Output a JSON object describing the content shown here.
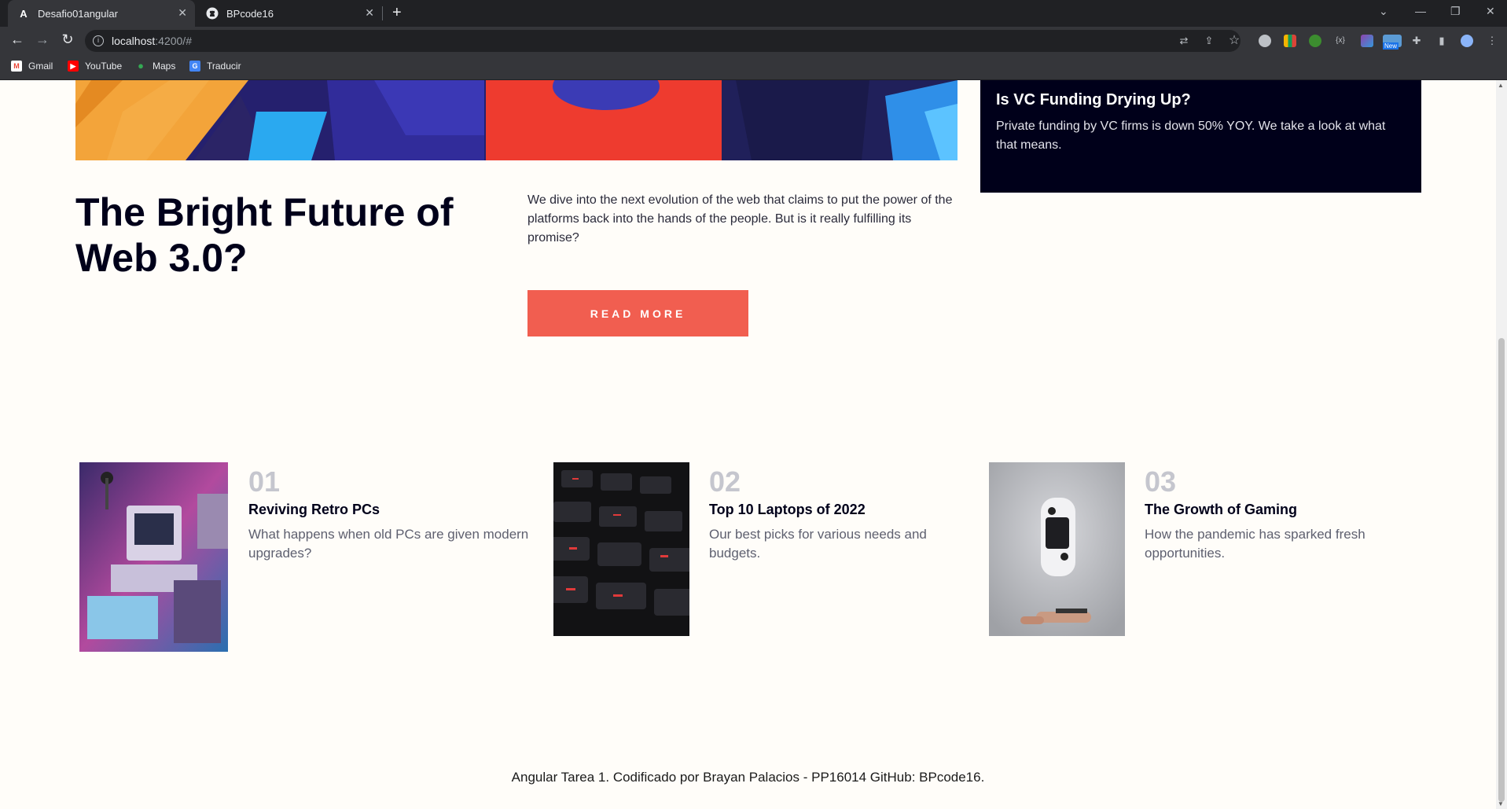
{
  "browser": {
    "tabs": [
      {
        "title": "Desafio01angular",
        "favicon": "angular-icon",
        "active": true
      },
      {
        "title": "BPcode16",
        "favicon": "github-icon",
        "active": false
      }
    ],
    "url": {
      "host": "localhost",
      "path": ":4200/#"
    },
    "bookmarks": [
      {
        "label": "Gmail",
        "icon": "gmail-icon"
      },
      {
        "label": "YouTube",
        "icon": "youtube-icon"
      },
      {
        "label": "Maps",
        "icon": "maps-icon"
      },
      {
        "label": "Traducir",
        "icon": "translate-icon"
      }
    ],
    "ext_badge": "New"
  },
  "hero": {
    "title": "The Bright Future of Web 3.0?",
    "description": "We dive into the next evolution of the web that claims to put the power of the platforms back into the hands of the people. But is it really fulfilling its promise?",
    "button": "READ MORE"
  },
  "sidebar_card": {
    "title": "Is VC Funding Drying Up?",
    "text": "Private funding by VC firms is down 50% YOY. We take a look at what that means."
  },
  "articles": [
    {
      "number": "01",
      "title": "Reviving Retro PCs",
      "description": "What happens when old PCs are given modern upgrades?",
      "image": "retro-pc-image"
    },
    {
      "number": "02",
      "title": "Top 10 Laptops of 2022",
      "description": "Our best picks for various needs and budgets.",
      "image": "keyboard-image"
    },
    {
      "number": "03",
      "title": "The Growth of Gaming",
      "description": "How the pandemic has sparked fresh opportunities.",
      "image": "gamepad-image"
    }
  ],
  "footer": "Angular Tarea 1. Codificado por Brayan Palacios - PP16014 GitHub: BPcode16.",
  "colors": {
    "accent": "#f15e50",
    "dark": "#00001a",
    "background": "#fffdf9",
    "muted": "#c5c6ce"
  }
}
